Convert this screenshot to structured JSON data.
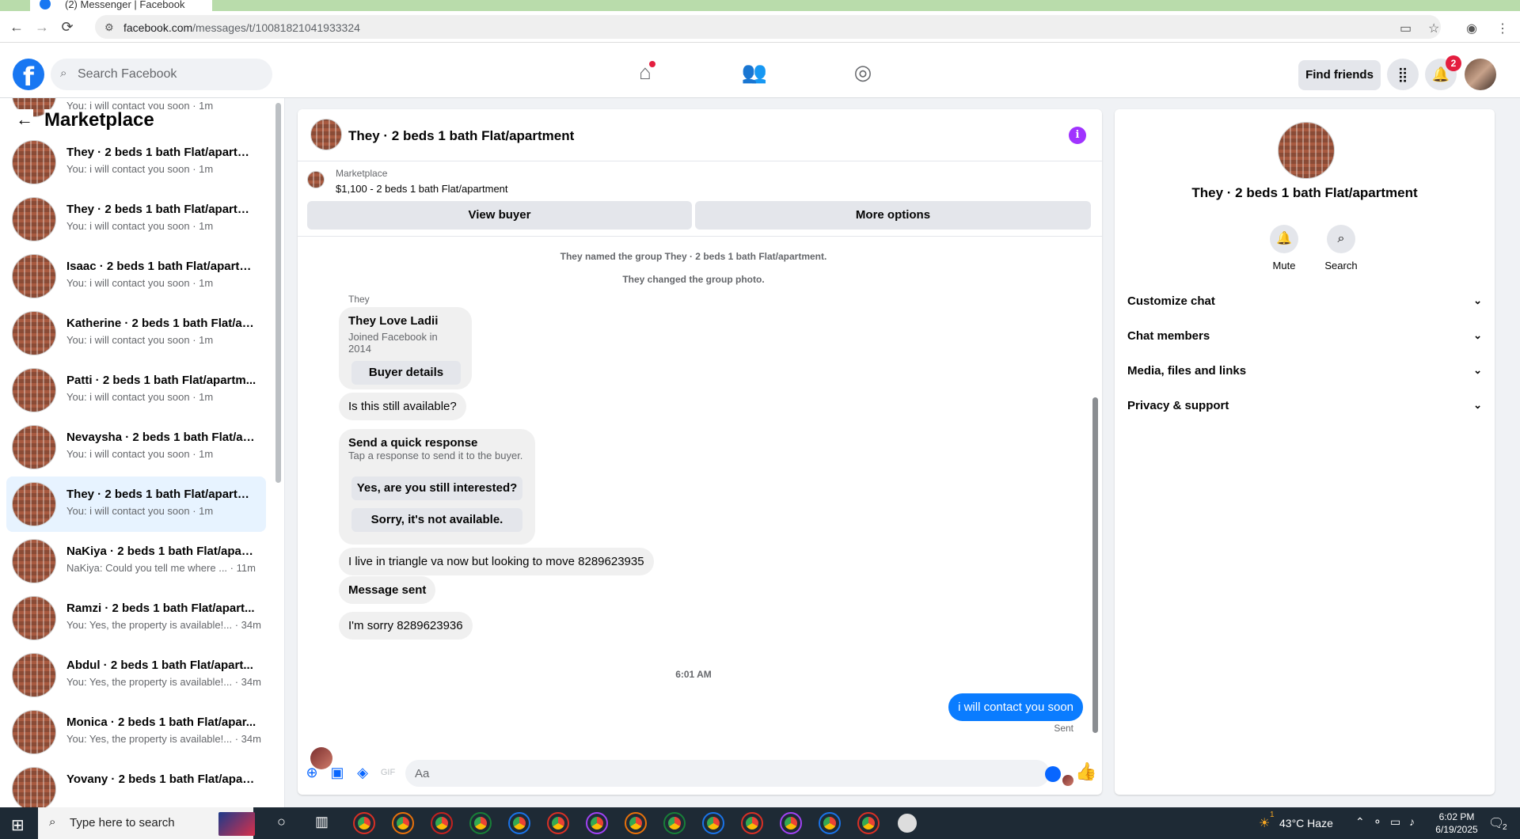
{
  "browser": {
    "tab_title": "(2) Messenger | Facebook",
    "url_domain": "facebook.com",
    "url_path": "/messages/t/10081821041933324"
  },
  "header": {
    "logo": "f",
    "search_placeholder": "Search Facebook",
    "find_friends": "Find friends",
    "notif_count": "2",
    "icons": [
      "home-icon",
      "friends-icon",
      "groups-icon",
      "menu-grid-icon",
      "bell-icon"
    ]
  },
  "sidebar": {
    "title": "Marketplace",
    "top_partial_preview": "You: i will contact you soon · 1m",
    "conversations": [
      {
        "name": "They · 2 beds 1 bath Flat/apartm...",
        "preview": "You: i will contact you soon · 1m"
      },
      {
        "name": "They · 2 beds 1 bath Flat/apartm...",
        "preview": "You: i will contact you soon · 1m"
      },
      {
        "name": "Isaac · 2 beds 1 bath Flat/apartm...",
        "preview": "You: i will contact you soon · 1m"
      },
      {
        "name": "Katherine · 2 beds 1 bath Flat/ap...",
        "preview": "You: i will contact you soon · 1m"
      },
      {
        "name": "Patti · 2 beds 1 bath Flat/apartm...",
        "preview": "You: i will contact you soon · 1m"
      },
      {
        "name": "Nevaysha · 2 beds 1 bath Flat/ap...",
        "preview": "You: i will contact you soon · 1m"
      },
      {
        "name": "They · 2 beds 1 bath Flat/apartm...",
        "preview": "You: i will contact you soon · 1m"
      },
      {
        "name": "NaKiya · 2 beds 1 bath Flat/apart...",
        "preview": "NaKiya: Could you tell me where ... · 11m"
      },
      {
        "name": "Ramzi · 2 beds 1 bath Flat/apart...",
        "preview": "You: Yes, the property is available!... · 34m"
      },
      {
        "name": "Abdul · 2 beds 1 bath Flat/apart...",
        "preview": "You: Yes, the property is available!... · 34m"
      },
      {
        "name": "Monica · 2 beds 1 bath Flat/apar...",
        "preview": "You: Yes, the property is available!... · 34m"
      },
      {
        "name": "Yovany · 2 beds 1 bath Flat/apart...",
        "preview": ""
      }
    ]
  },
  "chat": {
    "title": "They · 2 beds 1 bath Flat/apartment",
    "marketplace_label": "Marketplace",
    "listing_price": "$1,100 - 2 beds 1 bath Flat/apartment",
    "view_buyer": "View buyer",
    "more_options": "More options",
    "system_1": "They named the group They · 2 beds 1 bath Flat/apartment.",
    "system_2": "They changed the group photo.",
    "sender_name": "They",
    "buyer_card": {
      "name": "They Love Ladii",
      "joined": "Joined Facebook in 2014",
      "button": "Buyer details"
    },
    "msg_available": "Is this still available?",
    "quick_response": {
      "title": "Send a quick response",
      "subtitle": "Tap a response to send it to the buyer.",
      "option_1": "Yes, are you still interested?",
      "option_2": "Sorry, it's not available."
    },
    "msg_triangle": "I live in triangle va now but looking to move 8289623935",
    "msg_sent_notice": "Message sent",
    "msg_sorry": "I'm sorry 8289623936",
    "timestamp": "6:01 AM",
    "outgoing": "i will contact you soon",
    "status": "Sent",
    "composer_placeholder": "Aa"
  },
  "details": {
    "title": "They · 2 beds 1 bath Flat/apartment",
    "mute": "Mute",
    "search": "Search",
    "sections": [
      "Customize chat",
      "Chat members",
      "Media, files and links",
      "Privacy & support"
    ]
  },
  "taskbar": {
    "search_placeholder": "Type here to search",
    "weather": "43°C  Haze",
    "weather_alert": "1",
    "time": "6:02 PM",
    "date": "6/19/2025",
    "notif_count": "2"
  }
}
